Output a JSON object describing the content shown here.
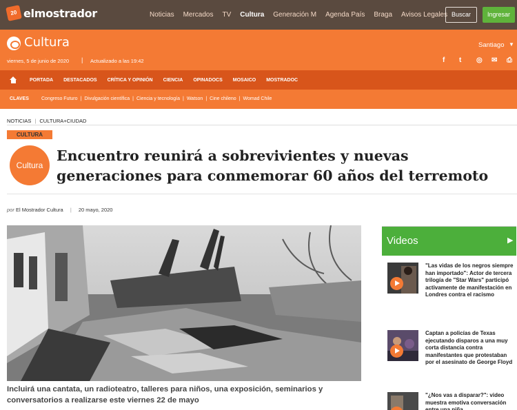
{
  "brand": {
    "name": "elmostrador",
    "badge": "20"
  },
  "topnav": {
    "items": [
      "Noticias",
      "Mercados",
      "TV",
      "Cultura",
      "Generación M",
      "Agenda País",
      "Braga",
      "Avisos Legales"
    ],
    "active": "Cultura"
  },
  "buttons": {
    "search": "Buscar",
    "login": "Ingresar"
  },
  "section": {
    "title": "Cultura",
    "date": "viernes, 5 de junio de 2020",
    "separator": "|",
    "updated": "Actualizado a las 19:42",
    "city": "Santiago",
    "social": [
      "facebook-icon",
      "twitter-icon",
      "instagram-icon",
      "mail-icon",
      "print-icon"
    ]
  },
  "nav": {
    "items": [
      "PORTADA",
      "DESTACADOS",
      "CRÍTICA Y OPINIÓN",
      "CIENCIA",
      "OPINADOCS",
      "MOSAICO",
      "MOSTRADOC"
    ]
  },
  "claves": {
    "label": "CLAVES",
    "tags": [
      "Congreso Futuro",
      "Divulgación científica",
      "Ciencia y tecnología",
      "Watson",
      "Cine chileno",
      "Womad Chile"
    ]
  },
  "breadcrumb": [
    "NOTICIAS",
    "CULTURA+CIUDAD"
  ],
  "article": {
    "category": "CULTURA",
    "badge": "Cultura",
    "title": "Encuentro reunirá a sobrevivientes y nuevas generaciones para conmemorar 60 años del terremoto",
    "by_prefix": "por",
    "author": "El Mostrador Cultura",
    "date": "20 mayo, 2020",
    "caption": "Incluirá una cantata, un radioteatro, talleres para niños, una exposición, seminarios y conversatorios a realizarse este viernes 22 de mayo"
  },
  "sidebar": {
    "heading": "Videos",
    "videos": [
      {
        "title": "\"Las vidas de los negros siempre han importado\": Actor de tercera trilogía de \"Star Wars\" participó activamente de manifestación en Londres contra el racismo"
      },
      {
        "title": "Captan a policías de Texas ejecutando disparos a una muy corta distancia contra manifestantes que protestaban por el asesinato de George Floyd"
      },
      {
        "title": "\"¿Nos vas a disparar?\": video muestra emotiva conversación entre una niña"
      }
    ]
  },
  "colors": {
    "topbar": "#5a4a3f",
    "orange": "#f47a34",
    "dark_orange": "#d8551b",
    "green": "#4caf3b"
  }
}
